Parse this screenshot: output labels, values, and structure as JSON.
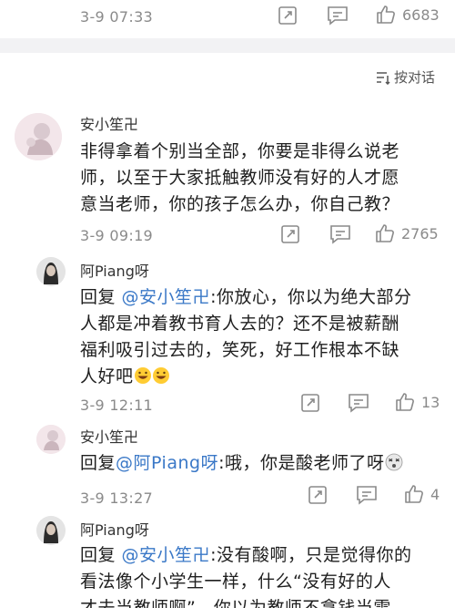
{
  "top_comment": {
    "time": "3-9 07:33",
    "likes": "6683"
  },
  "sort_toggle": {
    "label": "按对话",
    "icon": "sort-icon"
  },
  "comments": [
    {
      "name": "安小笙卍",
      "lines": [
        "非得拿着个别当全部，你要是非得么说老",
        "师，以至于大家抵触教师没有好的人才愿",
        "意当老师，你的孩子怎么办，你自己教？"
      ],
      "time": "3-9 09:19",
      "likes": "2765"
    },
    {
      "name": "阿Piang呀",
      "reply_prefix": "回复 ",
      "mention": "@安小笙卍",
      "line1_rest": ":你放心，你以为绝大部分",
      "lines": [
        "人都是冲着教书育人去的？还不是被薪酬",
        "福利吸引过去的，笑死，好工作根本不缺"
      ],
      "last_line": "人好吧",
      "emoji": "grinning-sweat-emoji",
      "time": "3-9 12:11",
      "likes": "13"
    },
    {
      "name": "安小笙卍",
      "reply_prefix": "回复",
      "mention": "@阿Piang呀",
      "line1_rest": ":哦，你是酸老师了呀",
      "emoji": "dizzy-face-emoji",
      "time": "3-9 13:27",
      "likes": "4"
    },
    {
      "name": "阿Piang呀",
      "reply_prefix": "回复 ",
      "mention": "@安小笙卍",
      "line1_rest": ":没有酸啊，只是觉得你的",
      "lines": [
        "看法像个小学生一样，什么“没有好的人",
        "才去当教师啊”，你以为教师不拿钱当雷"
      ]
    }
  ],
  "colors": {
    "mention": "#3a78c7",
    "meta": "#8a8a8a",
    "divider": "#f2f2f4"
  }
}
